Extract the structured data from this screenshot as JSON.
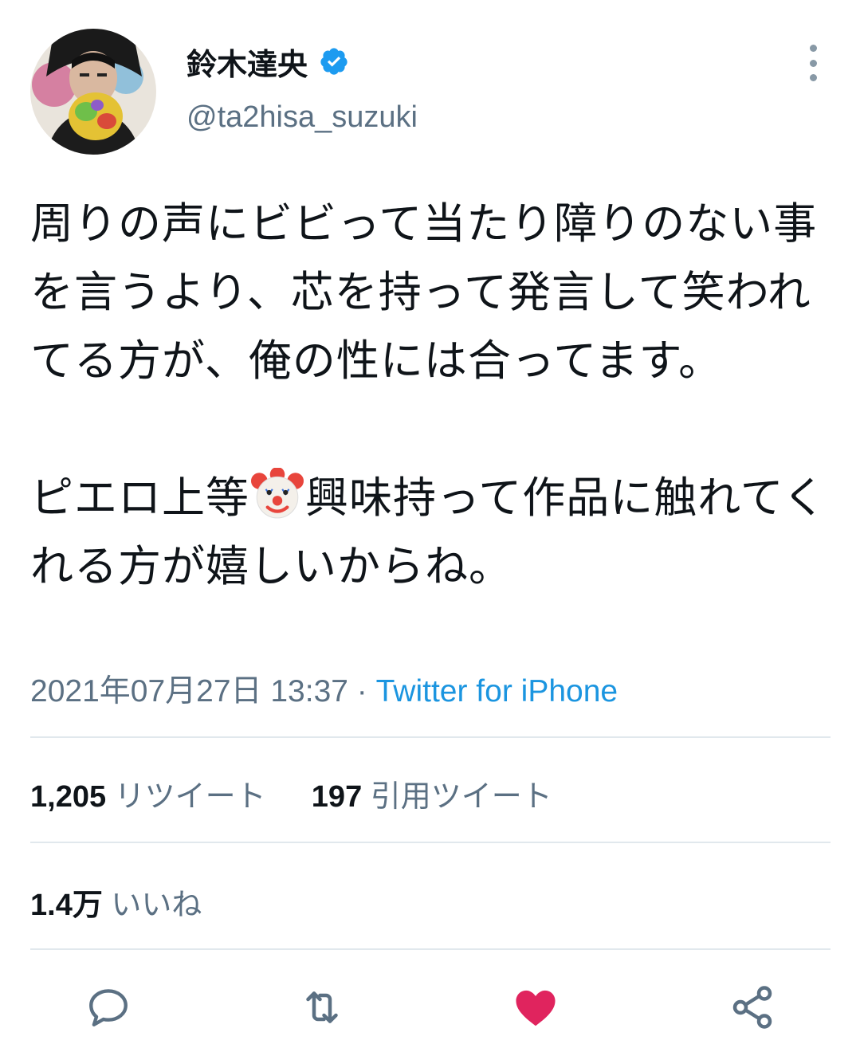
{
  "author": {
    "name": "鈴木達央",
    "handle": "@ta2hisa_suzuki",
    "verified": true
  },
  "tweet": {
    "text_part1": "周りの声にビビって当たり障りのない事を言うより、芯を持って発言して笑われてる方が、俺の性には合ってます。\n\nピエロ上等",
    "emoji": "clown-face",
    "text_part2": "興味持って作品に触れてくれる方が嬉しいからね。",
    "timestamp": "2021年07月27日 13:37",
    "separator": " · ",
    "source": "Twitter for iPhone"
  },
  "stats": {
    "retweets_count": "1,205",
    "retweets_label": "リツイート",
    "quotes_count": "197",
    "quotes_label": "引用ツイート",
    "likes_count": "1.4万",
    "likes_label": "いいね"
  },
  "actions": {
    "icons": [
      "reply-icon",
      "retweet-icon",
      "like-icon",
      "share-icon"
    ],
    "liked": true
  },
  "colors": {
    "accent": "#1b95e0",
    "verified": "#1d9bf0",
    "like": "#e0245e",
    "secondary_text": "#5b7083",
    "divider": "#e1e8ed"
  }
}
